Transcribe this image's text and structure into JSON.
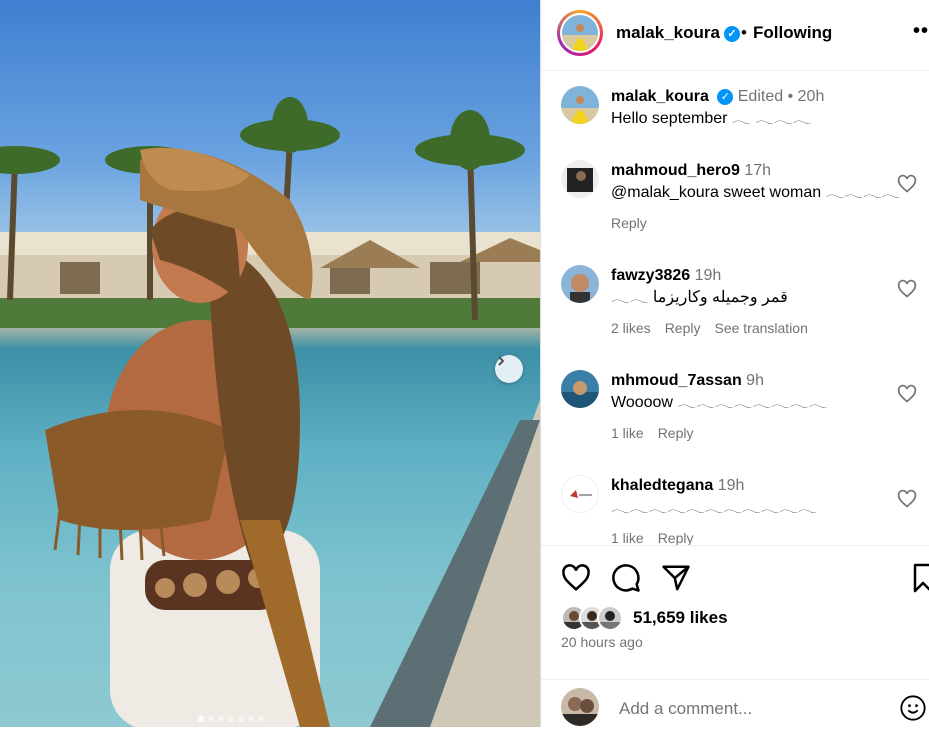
{
  "post": {
    "username": "malak_koura",
    "follow_separator": "•",
    "follow_label": "Following",
    "more_label": "•••",
    "caption_username": "malak_koura",
    "edited_label": "Edited",
    "dot": "•",
    "caption_time": "20h",
    "caption_text": "Hello september 𓂃 𓂃𓂃𓂃"
  },
  "comments": [
    {
      "user": "mahmoud_hero9",
      "time": "17h",
      "text": "@malak_koura sweet woman 𓂃𓂃𓂃𓂃",
      "likes": "",
      "reply": "Reply",
      "translation": ""
    },
    {
      "user": "fawzy3826",
      "time": "19h",
      "text": "قمر وجميله وكاريزما 𓂃𓂃",
      "likes": "2 likes",
      "reply": "Reply",
      "translation": "See translation"
    },
    {
      "user": "mhmoud_7assan",
      "time": "9h",
      "text": "Woooow 𓂃𓂃𓂃𓂃𓂃𓂃𓂃𓂃",
      "likes": "1 like",
      "reply": "Reply",
      "translation": ""
    },
    {
      "user": "khaledtegana",
      "time": "19h",
      "text": "𓂃𓂃𓂃𓂃𓂃𓂃𓂃𓂃𓂃𓂃𓂃",
      "likes": "1 like",
      "reply": "Reply",
      "translation": ""
    }
  ],
  "stats": {
    "likes": "51,659 likes",
    "posted": "20 hours ago"
  },
  "composer": {
    "placeholder": "Add a comment..."
  },
  "icons": {
    "like": "heart-icon",
    "comment": "comment-icon",
    "share": "share-icon",
    "save": "bookmark-icon",
    "next": "chevron-right-icon",
    "emoji": "emoji-icon"
  },
  "colors": {
    "verified": "#0095f6",
    "muted": "#737373"
  },
  "carousel": {
    "slides": 7,
    "active": 1
  }
}
